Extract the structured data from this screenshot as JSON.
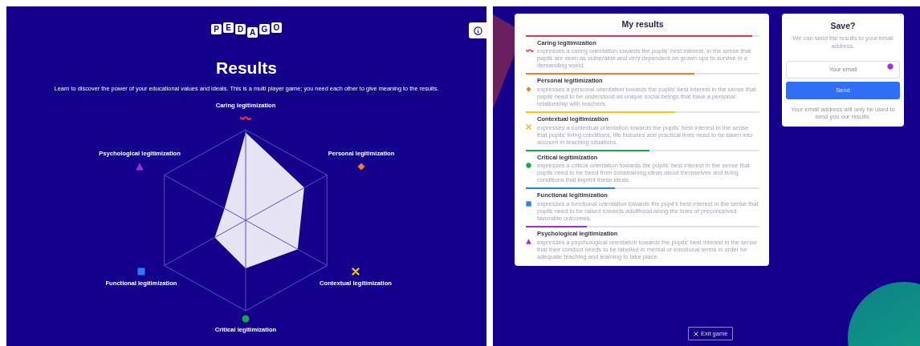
{
  "left_screen": {
    "logo_letters": [
      "P",
      "E",
      "D",
      "A",
      "G",
      "O"
    ],
    "title": "Results",
    "description": "Learn to discover the power of your educational values and ideals. This is a multi player game; you need each other to give meaning to the results.",
    "radar_axes": [
      {
        "label": "Caring legitimization",
        "kind": "wave",
        "color": "#e8334a"
      },
      {
        "label": "Psychological legitimization",
        "kind": "triangle",
        "color": "#9b30e0"
      },
      {
        "label": "Personal legitimization",
        "kind": "diamond",
        "color": "#f07d2c"
      },
      {
        "label": "Functional legitimization",
        "kind": "square",
        "color": "#2a7cf6"
      },
      {
        "label": "Contextual legitimization",
        "kind": "cross",
        "color": "#f5c518"
      },
      {
        "label": "Critical legitimization",
        "kind": "circle",
        "color": "#1aa34a"
      }
    ]
  },
  "right_screen": {
    "results_card": {
      "title": "My results",
      "items": [
        {
          "name": "Caring legitimization",
          "kind": "wave",
          "color": "#e8334a",
          "level": 0.97,
          "description": "expresses a caring orientation towards the pupils' best interest, in the sense that pupils are seen as vulnerable and very dependent on grown-ups to survive in a demanding world."
        },
        {
          "name": "Personal legitimization",
          "kind": "diamond",
          "color": "#f07d2c",
          "level": 0.72,
          "description": "expresses a personal orientation towards the pupils' best interest in the sense that pupils need to be understood as unique social beings that have a personal relationship with teachers."
        },
        {
          "name": "Contextual legitimization",
          "kind": "cross",
          "color": "#f5c518",
          "level": 0.64,
          "description": "expresses a contextual orientation towards the pupils' best interest in the sense that pupils' living conditions, life histories and practical lives need to be taken into account in teaching situations."
        },
        {
          "name": "Critical legitimization",
          "kind": "circle",
          "color": "#1aa34a",
          "level": 0.53,
          "description": "expresses a critical orientation towards the pupils' best interest in the sense that pupils need to be freed from constraining ideas about themselves and living conditions that imprint these ideas."
        },
        {
          "name": "Functional legitimization",
          "kind": "square",
          "color": "#2a7cf6",
          "level": 0.38,
          "description": "expresses a functional orientation towards the pupil's best interest in the sense that pupils need to be raised towards adulthood along the lines of preconceived favorable outcomes."
        },
        {
          "name": "Psychological legitimization",
          "kind": "triangle",
          "color": "#9b30e0",
          "level": 0.26,
          "description": "expresses a psychological orientation towards the pupils' best interest in the sense that their conduct needs to be labelled in mental or emotional terms in order for adequate teaching and learning to take place."
        }
      ]
    },
    "save_card": {
      "title": "Save?",
      "subtitle": "We can send the results to your email address.",
      "email_placeholder": "Your email",
      "send_button": "Send",
      "note": "Your email address will only be used to send you our results."
    },
    "exit_button": "Exit game"
  }
}
